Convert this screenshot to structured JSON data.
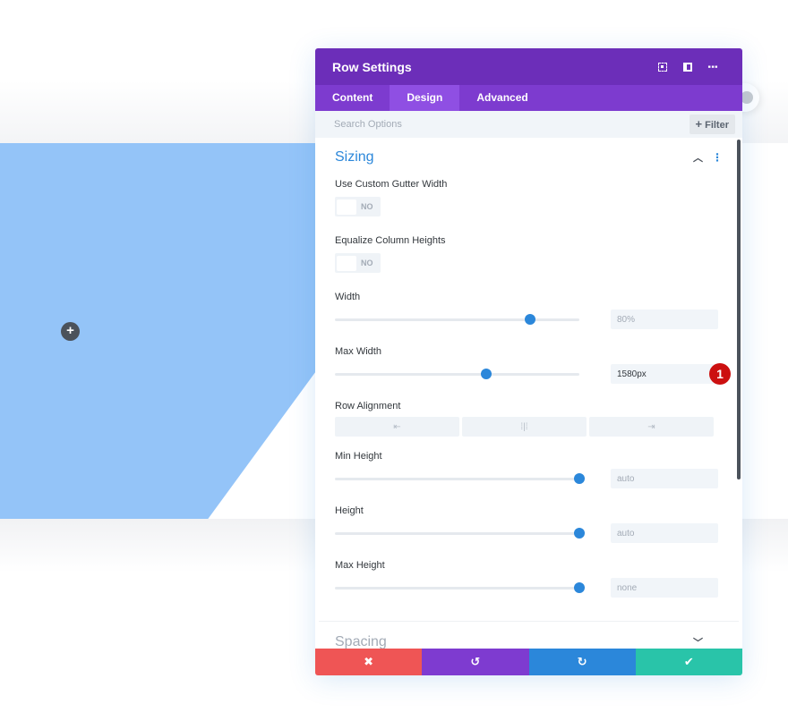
{
  "modal": {
    "title": "Row Settings",
    "header_icons": [
      "expand-icon",
      "split-view-icon",
      "more-options-icon"
    ],
    "tabs": [
      {
        "label": "Content",
        "active": false
      },
      {
        "label": "Design",
        "active": true
      },
      {
        "label": "Advanced",
        "active": false
      }
    ],
    "search": {
      "placeholder": "Search Options",
      "value": ""
    },
    "filter_label": "Filter"
  },
  "sizing": {
    "title": "Sizing",
    "use_custom_gutter": {
      "label": "Use Custom Gutter Width",
      "state": "NO"
    },
    "equalize_columns": {
      "label": "Equalize Column Heights",
      "state": "NO"
    },
    "width": {
      "label": "Width",
      "value": "80%",
      "slider_percent": 80
    },
    "max_width": {
      "label": "Max Width",
      "value": "1580px",
      "slider_percent": 62,
      "badge": "1"
    },
    "row_alignment": {
      "label": "Row Alignment",
      "options": [
        "left",
        "center",
        "right"
      ]
    },
    "min_height": {
      "label": "Min Height",
      "value": "auto",
      "slider_percent": 100
    },
    "height": {
      "label": "Height",
      "value": "auto",
      "slider_percent": 100
    },
    "max_height": {
      "label": "Max Height",
      "value": "none",
      "slider_percent": 100
    }
  },
  "spacing": {
    "title": "Spacing"
  },
  "footer": {
    "cancel": "✖",
    "undo": "↺",
    "redo": "↻",
    "save": "✔"
  },
  "colors": {
    "header": "#6c2eb9",
    "tabs": "#7d3bcf",
    "active_tab": "#8f4fe3",
    "accent": "#2b87da",
    "cancel": "#ef5555",
    "undo": "#7e3bd0",
    "redo": "#2b87da",
    "save": "#29c4a9",
    "section_background": "#94c4f8",
    "badge": "#cc1010"
  }
}
